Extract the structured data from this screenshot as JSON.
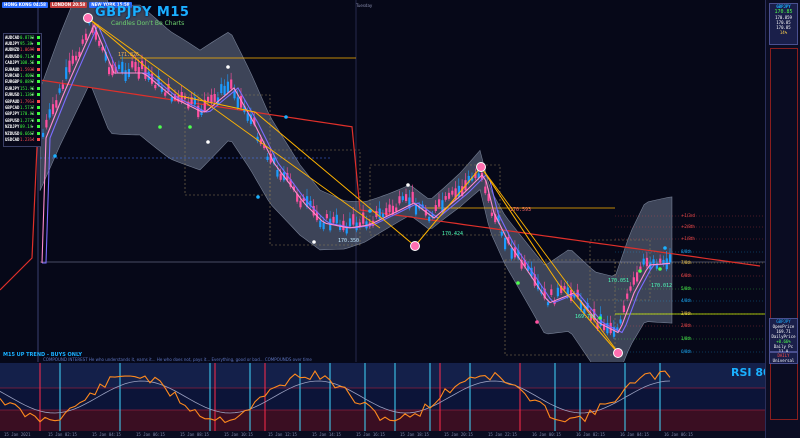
{
  "chart": {
    "symbol_title": "GBPJPY M15",
    "subtitle": "Candles Don't Be Charts",
    "day_label": "Tuesday",
    "top_badges": [
      {
        "label": "HONG KONG 04:58",
        "color": "#2a6cff"
      },
      {
        "label": "LONDON 20:58",
        "color": "#c23c3c"
      },
      {
        "label": "NEW YORK 15:58",
        "color": "#2a6cff"
      }
    ],
    "pairs": [
      {
        "name": "AUDCAD",
        "value": "0.8783",
        "chg": "+",
        "color": "#3dff3d"
      },
      {
        "name": "AUDJPY",
        "value": "95.38",
        "chg": "+",
        "color": "#3dff3d"
      },
      {
        "name": "AUDNZD",
        "value": "1.0699",
        "chg": "-",
        "color": "#ff4d4d"
      },
      {
        "name": "AUDUSD",
        "value": "0.7134",
        "chg": "+",
        "color": "#3dff3d"
      },
      {
        "name": "CADJPY",
        "value": "108.55",
        "chg": "+",
        "color": "#3dff3d"
      },
      {
        "name": "EURAUD",
        "value": "1.5938",
        "chg": "-",
        "color": "#ff4d4d"
      },
      {
        "name": "EURCAD",
        "value": "1.4001",
        "chg": "+",
        "color": "#3dff3d"
      },
      {
        "name": "EURGBP",
        "value": "0.8897",
        "chg": "+",
        "color": "#3dff3d"
      },
      {
        "name": "EURJPY",
        "value": "151.96",
        "chg": "+",
        "color": "#3dff3d"
      },
      {
        "name": "EURUSD",
        "value": "1.1369",
        "chg": "+",
        "color": "#3dff3d"
      },
      {
        "name": "GBPAUD",
        "value": "1.7913",
        "chg": "-",
        "color": "#ff4d4d"
      },
      {
        "name": "GBPCAD",
        "value": "1.5737",
        "chg": "+",
        "color": "#3dff3d"
      },
      {
        "name": "GBPJPY",
        "value": "170.81",
        "chg": "+",
        "color": "#3dff3d"
      },
      {
        "name": "GBPUSD",
        "value": "1.2778",
        "chg": "+",
        "color": "#3dff3d"
      },
      {
        "name": "NZDJPY",
        "value": "89.14",
        "chg": "+",
        "color": "#3dff3d"
      },
      {
        "name": "NZDUSD",
        "value": "0.6667",
        "chg": "+",
        "color": "#3dff3d"
      },
      {
        "name": "USDCAD",
        "value": "1.2314",
        "chg": "-",
        "color": "#ff4d4d"
      }
    ],
    "price_tags": [
      {
        "text": "171.826",
        "color": "#ffb84d"
      },
      {
        "text": "170.350",
        "color": "#bfe8ff"
      },
      {
        "text": "170.424",
        "color": "#4dffb8"
      },
      {
        "text": "170.593",
        "color": "#ff6b6b"
      },
      {
        "text": "170.051",
        "color": "#4dffb8"
      },
      {
        "text": "170.012",
        "color": "#4dffb8"
      },
      {
        "text": "169.791",
        "color": "#4dffb8"
      }
    ],
    "levels": [
      {
        "label": "+1/3rd",
        "color": "#ff4d4d"
      },
      {
        "label": "+2/8th",
        "color": "#ff4d4d"
      },
      {
        "label": "+1/8th",
        "color": "#ff4d4d"
      },
      {
        "label": "8/8th",
        "color": "#1ab0ff"
      },
      {
        "label": "7/8th",
        "color": "#ffd24d"
      },
      {
        "label": "6/8th",
        "color": "#ff4d4d"
      },
      {
        "label": "5/8th",
        "color": "#4dff4d"
      },
      {
        "label": "4/8th",
        "color": "#1ab0ff"
      },
      {
        "label": "3/8th",
        "color": "#ffd24d"
      },
      {
        "label": "2/8th",
        "color": "#ff4d4d"
      },
      {
        "label": "1/8th",
        "color": "#4dff4d"
      },
      {
        "label": "0/8th",
        "color": "#1ab0ff"
      }
    ],
    "trend_label": "M15 UP TREND - BUYS ONLY",
    "quote": "COMPOUND INTEREST  He who understands it, earns it... He who does not, pays it...   Everything, good or bad... COMPOUNDS over time",
    "colors": {
      "bull": "#1a9bff",
      "bear": "#ff4fa0",
      "band_fill": "#b0c4e0",
      "ma_red": "#e0302a",
      "trend_line": "#ffb400"
    }
  },
  "right_panel": {
    "symbol": "GBPJPY",
    "price_main": "170.85",
    "price_lines": [
      "170.859",
      "170.85",
      "170.85"
    ],
    "spread": "14%",
    "info_box": {
      "lines": [
        "GBPJPY",
        "OpenPrice",
        "169.71",
        "DailyPrice",
        "+0.66%",
        "Daily Pc",
        "11.0"
      ]
    },
    "bottom_box": [
      "DAILY",
      "Universal"
    ]
  },
  "indicator": {
    "label": "RSI 80.5"
  },
  "axis": {
    "dates": [
      "15 Jan 2021",
      "15 Jan 02:15",
      "15 Jan 04:15",
      "15 Jan 06:15",
      "15 Jan 08:15",
      "15 Jan 10:15",
      "15 Jan 12:15",
      "15 Jan 14:15",
      "15 Jan 16:15",
      "15 Jan 18:15",
      "15 Jan 20:15",
      "15 Jan 22:15",
      "16 Jan 00:15",
      "16 Jan 02:15",
      "16 Jan 04:15",
      "16 Jan 06:15"
    ]
  }
}
